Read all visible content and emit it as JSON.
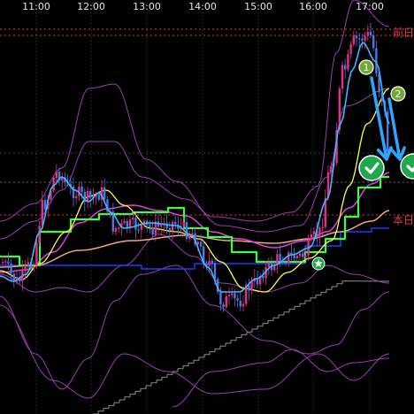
{
  "chart_data": {
    "type": "candlestick",
    "x_ticks": [
      "11:00",
      "12:00",
      "13:00",
      "14:00",
      "15:00",
      "16:00",
      "17:00"
    ],
    "side_labels": {
      "upper": "前日",
      "lower": "本日"
    },
    "markers": [
      {
        "label": "1",
        "kind": "number-circle"
      },
      {
        "label": "2",
        "kind": "number-circle"
      },
      {
        "label": "",
        "kind": "check-circle"
      },
      {
        "label": "",
        "kind": "check-circle"
      },
      {
        "label": "",
        "kind": "star-circle"
      }
    ],
    "grid": true,
    "colors": {
      "background": "#000000",
      "up_candle": "#e0308c",
      "down_candle": "#4a78e0",
      "short_ma": "#3fb6ff",
      "mid_ma": "#ffff40",
      "long_ma": "#e040e0",
      "cloud_line": "#3cff3c",
      "base_ma": "#f0a880",
      "flat_line": "#1e3cff",
      "band": "#9a3fb0",
      "step_line": "#8a8a8a",
      "arrow": "#2aa8ff",
      "check": "#1fa84a",
      "marker": "#6fa832",
      "ref_line": "#e23b3b"
    }
  }
}
